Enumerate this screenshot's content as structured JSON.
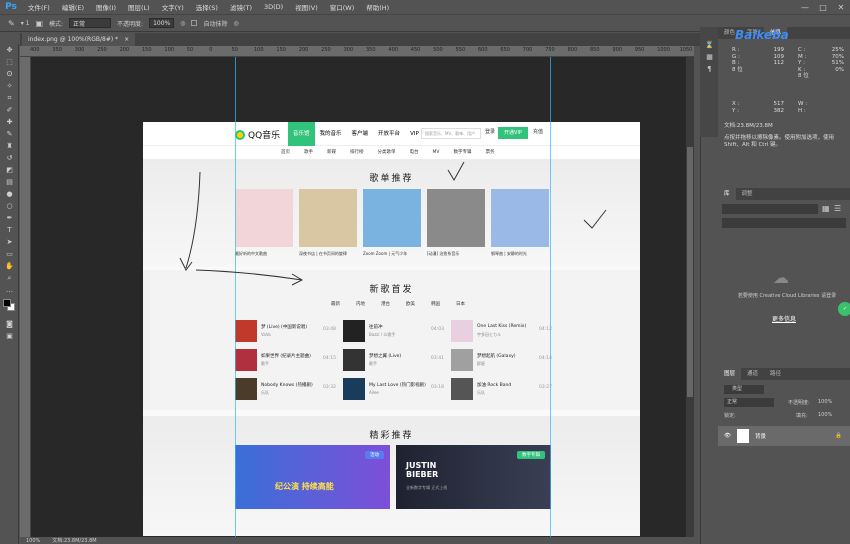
{
  "menubar": {
    "logo": "Ps",
    "items": [
      "文件(F)",
      "编辑(E)",
      "图像(I)",
      "图层(L)",
      "文字(Y)",
      "选择(S)",
      "滤镜(T)",
      "3D(D)",
      "视图(V)",
      "窗口(W)",
      "帮助(H)"
    ],
    "minimize": "—",
    "maximize": "□",
    "close": "✕"
  },
  "options": {
    "mode_label": "模式:",
    "mode_value": "正常",
    "opacity_label": "不透明度:",
    "opacity_value": "100%",
    "auto_erase": "自动抹除"
  },
  "document": {
    "tab_title": "index.png @ 100%(RGB/8#) *",
    "tab_close": "×",
    "zoom": "100%",
    "doc_size": "文档:23.8M/23.8M"
  },
  "ruler": [
    "400",
    "350",
    "300",
    "250",
    "200",
    "150",
    "100",
    "50",
    "0",
    "50",
    "100",
    "150",
    "200",
    "250",
    "300",
    "350",
    "400",
    "450",
    "500",
    "550",
    "600",
    "650",
    "700",
    "750",
    "800",
    "850",
    "900",
    "950",
    "1000",
    "1050"
  ],
  "webpage": {
    "logo_text": "QQ音乐",
    "nav": [
      "音乐馆",
      "我的音乐",
      "客户端",
      "开放平台",
      "VIP"
    ],
    "search_placeholder": "搜索音乐、MV、歌单、用户",
    "login": "登录",
    "open_vip": "开通VIP",
    "recharge": "充值",
    "subnav": [
      "首页",
      "歌手",
      "新碟",
      "排行榜",
      "分类歌单",
      "电台",
      "MV",
      "数字专辑",
      "票务"
    ],
    "section1": "歌单推荐",
    "playlists": [
      {
        "title": "最好听的中文歌曲",
        "color": "#f2d5d8"
      },
      {
        "title": "深夜书店 | 在书页间的旋律",
        "color": "#d9c6a3"
      },
      {
        "title": "Zoom Zoom | 元气少年",
        "color": "#7bb3e0"
      },
      {
        "title": "[动漫] 治愈系音乐",
        "color": "#8a8a8a"
      },
      {
        "title": "钢琴曲 | 安静的时光",
        "color": "#9bb9e6"
      }
    ],
    "section2": "新歌首发",
    "new_tabs": [
      "最新",
      "内地",
      "港台",
      "欧美",
      "韩国",
      "日本"
    ],
    "songs": [
      {
        "name": "梦 (Live) (中国新说唱)",
        "artist": "VaVa",
        "time": "03:48",
        "color": "#c0392b"
      },
      {
        "name": "如果世界 (纪录片主题曲)",
        "artist": "歌手",
        "time": "04:15",
        "color": "#b03040"
      },
      {
        "name": "Nobody Knows (热播剧)",
        "artist": "乐队",
        "time": "03:32",
        "color": "#4a3b2a"
      },
      {
        "name": "往前冲",
        "artist": "Bazzi / 众歌手",
        "time": "04:03",
        "color": "#222"
      },
      {
        "name": "梦想之翼 (Live)",
        "artist": "歌手",
        "time": "03:41",
        "color": "#333"
      },
      {
        "name": "My Last Love (热门影视剧)",
        "artist": "Ailee",
        "time": "03:18",
        "color": "#1a3c5c"
      },
      {
        "name": "One Last Kiss (Remix)",
        "artist": "宇多田ヒカル",
        "time": "04:12",
        "color": "#e8d0e0"
      },
      {
        "name": "梦想起航 (Galaxy)",
        "artist": "群星",
        "time": "04:14",
        "color": "#a0a0a0"
      },
      {
        "name": "加油 Rock Band",
        "artist": "乐队",
        "time": "03:27",
        "color": "#555"
      }
    ],
    "section3": "精彩推荐",
    "banner1_badge": "活动",
    "banner1_text": "纪公演 持续高能",
    "banner2_badge": "数字专辑",
    "banner2_title": "JUSTIN BIEBER",
    "banner2_sub": "全新数字专辑 正式上线"
  },
  "info_panel": {
    "tabs": [
      "颜色",
      "字符",
      "信息"
    ],
    "rgb": [
      [
        "R",
        "199"
      ],
      [
        "G",
        "109"
      ],
      [
        "B",
        "112"
      ]
    ],
    "bits": "8 位",
    "cmyk": [
      [
        "C",
        "25%"
      ],
      [
        "M",
        "70%"
      ],
      [
        "Y",
        "51%"
      ],
      [
        "K",
        "0%"
      ]
    ],
    "xy": [
      [
        "X",
        "517"
      ],
      [
        "Y",
        "382"
      ]
    ],
    "wh": [
      [
        "W",
        ""
      ],
      [
        "H",
        ""
      ]
    ],
    "doc": "文档:23.8M/23.8M",
    "hint": "点按并拖移以擦除像素。使用附加选项，使用 Shift、Alt 和 Ctrl 键。"
  },
  "libraries": {
    "tabs": [
      "库",
      "调整"
    ],
    "message": "若要使用 Creative Cloud Libraries 请登录",
    "link": "更多信息"
  },
  "layers": {
    "tabs": [
      "图层",
      "通道",
      "路径"
    ],
    "kind": "类型",
    "blend": "正常",
    "opacity_label": "不透明度:",
    "opacity": "100%",
    "lock_label": "锁定:",
    "fill_label": "填充:",
    "fill": "100%",
    "layer_name": "背景"
  },
  "watermark": "Baikeba",
  "colors": {
    "accent": "#31c27c",
    "guide": "#2bb9ff",
    "ps_blue": "#31a8ff"
  }
}
